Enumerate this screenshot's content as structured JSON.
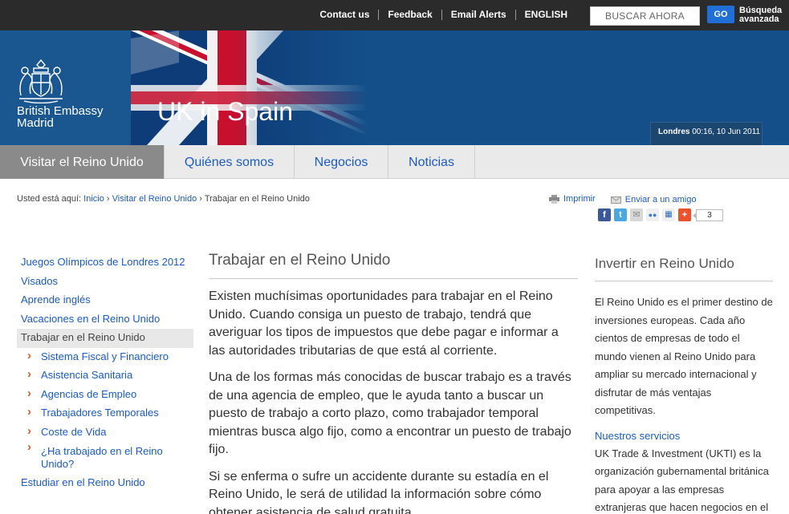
{
  "topbar": {
    "links": [
      "Contact us",
      "Feedback",
      "Email Alerts",
      "ENGLISH"
    ],
    "search_placeholder": "BUSCAR AHORA",
    "go_label": "GO",
    "advanced_search": "Búsqueda avanzada"
  },
  "banner": {
    "embassy_line1": "British Embassy",
    "embassy_line2": "Madrid",
    "title": "UK in Spain",
    "clock_city": "Londres",
    "clock_time": "00:16, 10 Jun 2011"
  },
  "nav": {
    "tabs": [
      "Visitar el Reino Unido",
      "Quiénes somos",
      "Negocios",
      "Noticias"
    ]
  },
  "breadcrumb": {
    "prefix": "Usted está aquí:",
    "items": [
      "Inicio",
      "Visitar el Reino Unido",
      "Trabajar en el Reino Unido"
    ],
    "separator": "›"
  },
  "tools": {
    "print": "Imprimir",
    "email": "Enviar a un amigo",
    "share_count": "3"
  },
  "leftnav": {
    "items": [
      "Juegos Olímpicos de Londres 2012",
      "Visados",
      "Aprende inglés",
      "Vacaciones en el Reino Unido",
      "Trabajar en el Reino Unido"
    ],
    "subitems": [
      "Sistema Fiscal y Financiero",
      "Asistencia Sanitaria",
      "Agencias de Empleo",
      "Trabajadores Temporales",
      "Coste de Vida",
      "¿Ha trabajado en el Reino Unido?"
    ],
    "last": "Estudiar en el Reino Unido"
  },
  "main": {
    "title": "Trabajar en el Reino Unido",
    "paragraphs": [
      "Existen muchísimas oportunidades para trabajar en el Reino Unido. Cuando consiga un puesto de trabajo, tendrá que averiguar los tipos de impuestos que debe pagar e informar a las autoridades tributarias de que está al corriente.",
      "Una de los formas más conocidas de buscar trabajo es a través de una agencia de empleo, que le ayuda tanto a buscar un puesto de trabajo a corto plazo, como trabajador temporal mientras busca algo fijo, como a encontrar un puesto de trabajo fijo.",
      "Si se enferma o sufre un accidente durante su estadía en el Reino Unido, le será de utilidad la información sobre cómo obtener asistencia de salud gratuita."
    ]
  },
  "right": {
    "title": "Invertir en Reino Unido",
    "paragraph1": "El Reino Unido es el primer destino de inversiones europeas. Cada año cientos de empresas de todo el mundo vienen al Reino Unido para ampliar su mercado internacional y disfrutar de más ventajas competitivas.",
    "link": "Nuestros servicios",
    "paragraph2": "UK Trade & Investment (UKTI) es la organización gubernamental británica para apoyar a las empresas extranjeras que hacen negocios en el"
  }
}
